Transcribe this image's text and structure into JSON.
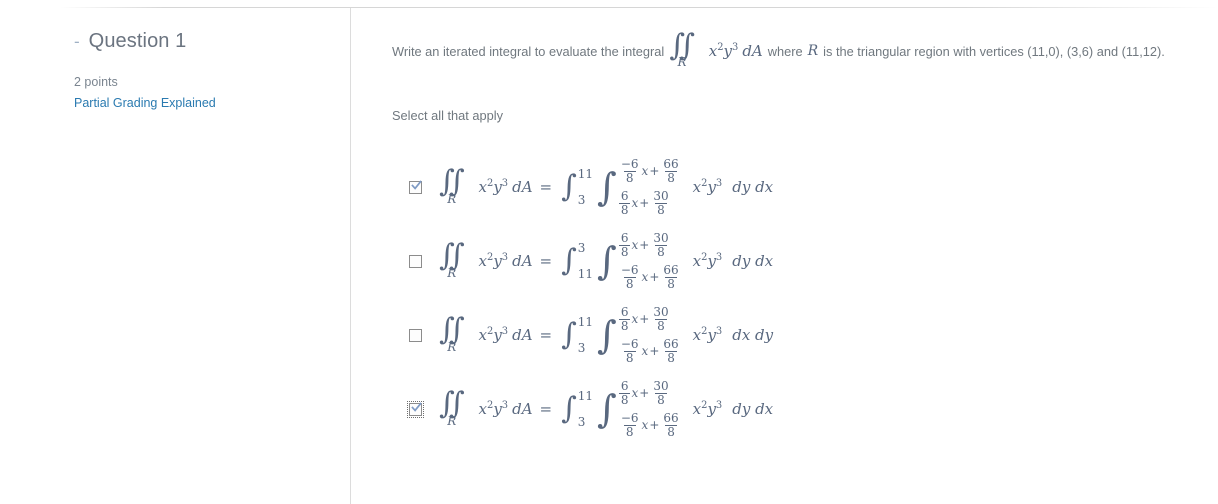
{
  "question": {
    "collapse_toggle": "-",
    "title": "Question 1",
    "points": "2 points",
    "partial_grading_link": "Partial Grading Explained"
  },
  "prompt": {
    "lead_text": "Write an iterated integral to evaluate the integral",
    "integral": {
      "symbol": "∬",
      "subscript": "R",
      "integrand_base_x": "x",
      "integrand_exp_x": "2",
      "integrand_base_y": "y",
      "integrand_exp_y": "3",
      "measure": "dA"
    },
    "tail_text_1": "where",
    "region_symbol": "R",
    "tail_text_2": "is the triangular region with vertices (11,0), (3,6) and (11,12).",
    "instruction": "Select all that apply"
  },
  "math_tokens": {
    "x": "x",
    "y": "y",
    "exp2": "2",
    "exp3": "3",
    "dA": "dA",
    "R": "R",
    "equals": "=",
    "plus": "+",
    "dydx": "dy dx",
    "dxdy": "dx dy",
    "double_integral": "∬",
    "integral": "∫",
    "num_neg6": "−6",
    "num_6": "6",
    "den_8": "8",
    "num_66": "66",
    "num_30": "30"
  },
  "options": [
    {
      "id": "option-1",
      "checked": true,
      "focused": false,
      "outer_lower": "3",
      "outer_upper": "11",
      "inner_upper": {
        "coef_num": "−6",
        "coef_den": "8",
        "var": "x",
        "const_num": "66",
        "const_den": "8"
      },
      "inner_lower": {
        "coef_num": "6",
        "coef_den": "8",
        "var": "x",
        "const_num": "30",
        "const_den": "8"
      },
      "differentials": "dy dx"
    },
    {
      "id": "option-2",
      "checked": false,
      "focused": false,
      "outer_lower": "11",
      "outer_upper": "3",
      "inner_upper": {
        "coef_num": "6",
        "coef_den": "8",
        "var": "x",
        "const_num": "30",
        "const_den": "8"
      },
      "inner_lower": {
        "coef_num": "−6",
        "coef_den": "8",
        "var": "x",
        "const_num": "66",
        "const_den": "8"
      },
      "differentials": "dy dx"
    },
    {
      "id": "option-3",
      "checked": false,
      "focused": false,
      "outer_lower": "3",
      "outer_upper": "11",
      "inner_upper": {
        "coef_num": "6",
        "coef_den": "8",
        "var": "x",
        "const_num": "30",
        "const_den": "8"
      },
      "inner_lower": {
        "coef_num": "−6",
        "coef_den": "8",
        "var": "x",
        "const_num": "66",
        "const_den": "8"
      },
      "differentials": "dx dy"
    },
    {
      "id": "option-4",
      "checked": true,
      "focused": true,
      "outer_lower": "3",
      "outer_upper": "11",
      "inner_upper": {
        "coef_num": "6",
        "coef_den": "8",
        "var": "x",
        "const_num": "30",
        "const_den": "8"
      },
      "inner_lower": {
        "coef_num": "−6",
        "coef_den": "8",
        "var": "x",
        "const_num": "66",
        "const_den": "8"
      },
      "differentials": "dy dx"
    }
  ],
  "colors": {
    "math_text": "#59687f",
    "body_text": "#70787f",
    "heading_text": "#6b7480",
    "link": "#2a7ab0",
    "divider": "#dcdcdc"
  }
}
